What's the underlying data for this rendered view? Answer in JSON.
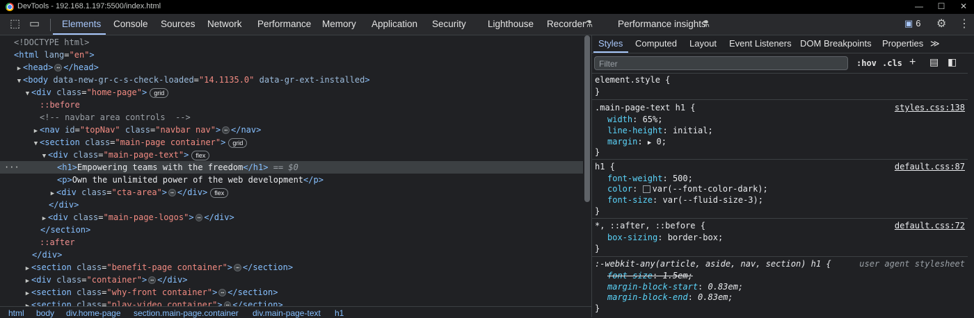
{
  "window": {
    "title": "DevTools - 192.168.1.197:5500/index.html",
    "controls": [
      "—",
      "☐",
      "✕"
    ]
  },
  "tabs": [
    {
      "label": "Elements",
      "active": true
    },
    {
      "label": "Console"
    },
    {
      "label": "Sources"
    },
    {
      "label": "Network"
    },
    {
      "label": "Performance"
    },
    {
      "label": "Memory"
    },
    {
      "label": "Application"
    },
    {
      "label": "Security"
    },
    {
      "label": "Lighthouse"
    },
    {
      "label": "Recorder"
    },
    {
      "label": "Performance insights"
    }
  ],
  "issues_count": "6",
  "dom": {
    "doctype": "<!DOCTYPE html>",
    "html_tag": "html",
    "html_attr": "lang",
    "html_val": "\"en\"",
    "head": "head",
    "body_tag": "body",
    "body_attr1": "data-new-gr-c-s-check-loaded",
    "body_val1": "\"14.1135.0\"",
    "body_attr2": "data-gr-ext-installed",
    "div": "div",
    "section": "section",
    "nav": "nav",
    "p": "p",
    "h1": "h1",
    "class": "class",
    "id": "id",
    "home_page": "\"home-page\"",
    "before": "::before",
    "after": "::after",
    "comment": "<!-- navbar area controls  -->",
    "nav_id": "\"topNav\"",
    "nav_class": "\"navbar nav\"",
    "main_page": "\"main-page container\"",
    "main_page_text": "\"main-page-text\"",
    "h1_text": "Empowering teams with the freedom",
    "dollar": "== $0",
    "p_text": "Own the unlimited power of the web development",
    "cta": "\"cta-area\"",
    "logos": "\"main-page-logos\"",
    "benefit": "\"benefit-page container\"",
    "container": "\"container\"",
    "why": "\"why-front container\"",
    "play": "\"play-video container\"",
    "grid": "grid",
    "flex": "flex",
    "ellipsis": "⋯"
  },
  "breadcrumbs": [
    "html",
    "body",
    "div.home-page",
    "section.main-page.container",
    "div.main-page-text",
    "h1"
  ],
  "styles_tabs": [
    "Styles",
    "Computed",
    "Layout",
    "Event Listeners",
    "DOM Breakpoints",
    "Properties"
  ],
  "styles_more": "≫",
  "filter_placeholder": "Filter",
  "hov": ":hov",
  "cls": ".cls",
  "rules": {
    "element_style": "element.style {",
    "close": "}",
    "r1_selector": ".main-page-text h1 {",
    "r1_source": "styles.css:138",
    "r1_p1": "width",
    "r1_v1": "65%;",
    "r1_p2": "line-height",
    "r1_v2": "initial;",
    "r1_p3": "margin",
    "r1_v3": "0;",
    "r2_selector": "h1 {",
    "r2_source": "default.css:87",
    "r2_p1": "font-weight",
    "r2_v1": "500;",
    "r2_p2": "color",
    "r2_v2": "var(--font-color-dark);",
    "r2_p3": "font-size",
    "r2_v3": "var(--fluid-size-3);",
    "r3_selector": "*, ::after, ::before {",
    "r3_source": "default.css:72",
    "r3_p1": "box-sizing",
    "r3_v1": "border-box;",
    "r4_selector": ":-webkit-any(article, aside, nav, section) h1 {",
    "r4_source": "user agent stylesheet",
    "r4_p1": "font-size",
    "r4_v1": "1.5em;",
    "r4_p2": "margin-block-start",
    "r4_v2": "0.83em;",
    "r4_p3": "margin-block-end",
    "r4_v3": "0.83em;"
  }
}
